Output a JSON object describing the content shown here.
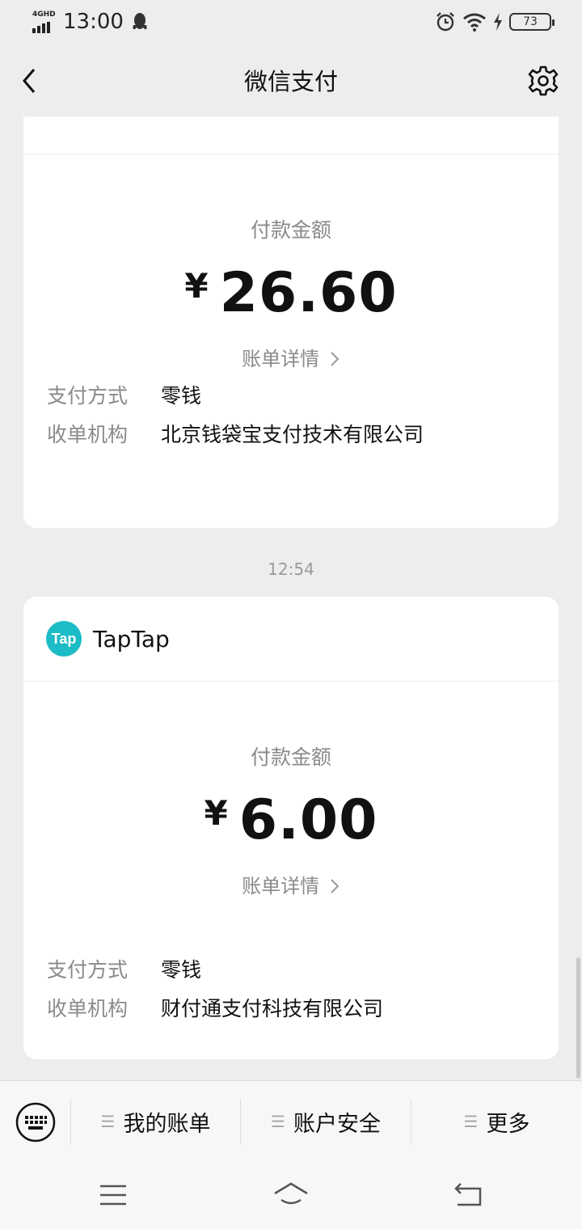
{
  "status_bar": {
    "network": "4GHD",
    "time": "13:00",
    "battery": "73"
  },
  "header": {
    "title": "微信支付"
  },
  "cards": [
    {
      "amount_label": "付款金额",
      "currency": "¥",
      "amount": "26.60",
      "detail_link": "账单详情",
      "payment_method_label": "支付方式",
      "payment_method": "零钱",
      "acquirer_label": "收单机构",
      "acquirer": "北京钱袋宝支付技术有限公司"
    },
    {
      "merchant": "TapTap",
      "merchant_logo_text": "Tap",
      "amount_label": "付款金额",
      "currency": "¥",
      "amount": "6.00",
      "detail_link": "账单详情",
      "payment_method_label": "支付方式",
      "payment_method": "零钱",
      "acquirer_label": "收单机构",
      "acquirer": "财付通支付科技有限公司"
    }
  ],
  "time_separator": "12:54",
  "bottom_menu": {
    "items": [
      {
        "label": "我的账单"
      },
      {
        "label": "账户安全"
      },
      {
        "label": "更多"
      }
    ]
  },
  "icons": {
    "back": "chevron-left-icon",
    "settings": "gear-icon",
    "keyboard": "keyboard-icon",
    "nav_menu": "menu-icon",
    "nav_home": "home-icon",
    "nav_back": "return-icon"
  },
  "colors": {
    "background": "#ededed",
    "card": "#ffffff",
    "taptap_brand": "#1bbcc6"
  }
}
